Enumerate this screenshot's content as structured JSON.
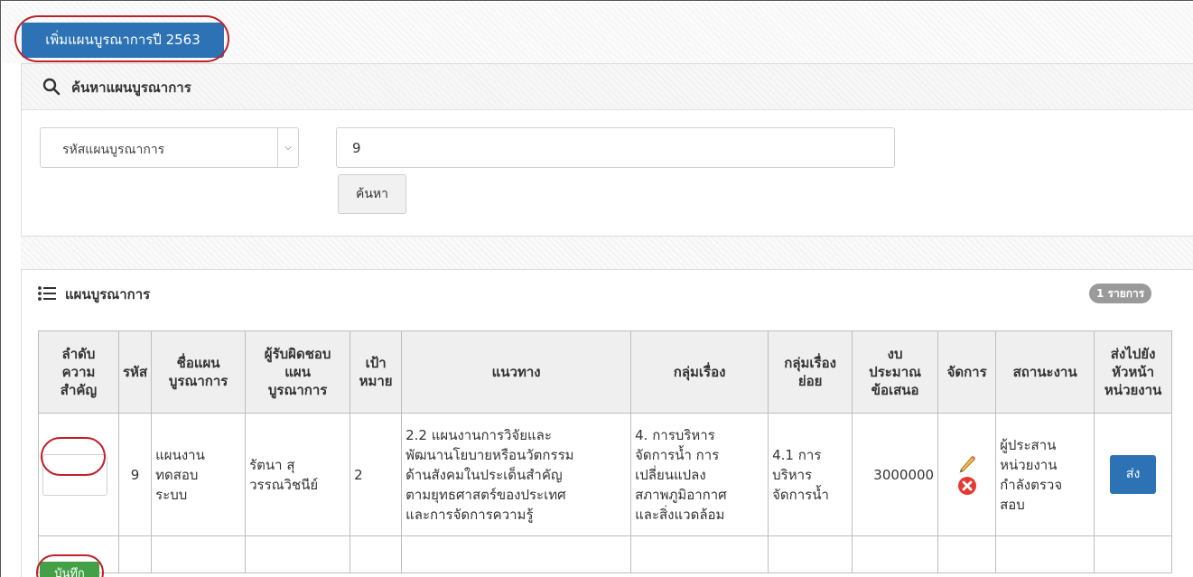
{
  "toolbar": {
    "add_plan_label": "เพิ่มแผนบูรณาการปี 2563"
  },
  "search": {
    "title": "ค้นหาแผนบูรณาการ",
    "field_selected": "รหัสแผนบูรณาการ",
    "query_value": "9",
    "search_button": "ค้นหา",
    "icon": "search-icon"
  },
  "plans": {
    "title": "แผนบูรณาการ",
    "icon": "list-icon",
    "count_badge": "1 รายการ",
    "columns": [
      "ลำดับความสำคัญ",
      "รหัส",
      "ชื่อแผนบูรณาการ",
      "ผู้รับผิดชอบแผนบูรณาการ",
      "เป้าหมาย",
      "แนวทาง",
      "กลุ่มเรื่อง",
      "กลุ่มเรื่องย่อย",
      "งบประมาณข้อเสนอ",
      "จัดการ",
      "สถานะงาน",
      "ส่งไปยังหัวหน้าหน่วยงาน"
    ],
    "col_lines": {
      "c0": [
        "ลำดับ",
        "ความ",
        "สำคัญ"
      ],
      "c1": [
        "รหัส"
      ],
      "c2": [
        "ชื่อแผน",
        "บูรณาการ"
      ],
      "c3": [
        "ผู้รับผิดชอบ",
        "แผน",
        "บูรณาการ"
      ],
      "c4": [
        "เป้า",
        "หมาย"
      ],
      "c5": [
        "แนวทาง"
      ],
      "c6": [
        "กลุ่มเรื่อง"
      ],
      "c7": [
        "กลุ่มเรื่อง",
        "ย่อย"
      ],
      "c8": [
        "งบ",
        "ประมาณ",
        "ข้อเสนอ"
      ],
      "c9": [
        "จัดการ"
      ],
      "c10": [
        "สถานะงาน"
      ],
      "c11": [
        "ส่งไปยัง",
        "หัวหน้า",
        "หน่วยงาน"
      ]
    },
    "rows": [
      {
        "priority": "",
        "code": "9",
        "name_lines": [
          "แผนงาน",
          "ทดสอบ",
          "ระบบ"
        ],
        "owner_lines": [
          "รัตนา สุ",
          "วรรณวิชนีย์"
        ],
        "target": "2",
        "approach_lines": [
          "2.2 แผนงานการวิจัยและ",
          "พัฒนานโยบายหรือนวัตกรรม",
          "ด้านสังคมในประเด็นสำคัญ",
          "ตามยุทธศาสตร์ของประเทศ",
          "และการจัดการความรู้"
        ],
        "topic_lines": [
          "4. การบริหาร",
          "จัดการน้ำ การ",
          "เปลี่ยนแปลง",
          "สภาพภูมิอากาศ",
          "และสิ่งแวดล้อม"
        ],
        "subtopic_lines": [
          "4.1 การ",
          "บริหาร",
          "จัดการน้ำ"
        ],
        "budget": "3000000",
        "status_lines": [
          "ผู้ประสาน",
          "หน่วยงาน",
          "กำลังตรวจ",
          "สอบ"
        ],
        "send_label": "ส่ง",
        "edit_icon": "pencil-icon",
        "delete_icon": "delete-x-icon"
      }
    ],
    "save_label": "บันทึก"
  },
  "colors": {
    "primary": "#2d72b5",
    "success": "#43a047",
    "danger": "#e53935",
    "annotation": "#c0202a",
    "badge": "#9a9a9a"
  }
}
